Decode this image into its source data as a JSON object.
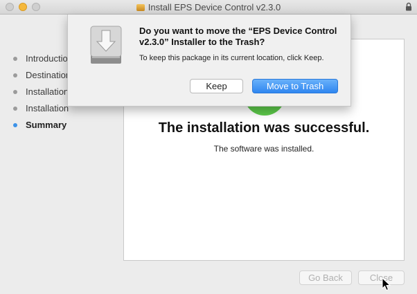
{
  "window": {
    "title": "Install EPS Device Control v2.3.0"
  },
  "sidebar": {
    "items": [
      {
        "label": "Introduction"
      },
      {
        "label": "Destination Select"
      },
      {
        "label": "Installation Type"
      },
      {
        "label": "Installation"
      },
      {
        "label": "Summary"
      }
    ],
    "active_index": 4
  },
  "content": {
    "headline": "The installation was successful.",
    "subline": "The software was installed."
  },
  "footer": {
    "back_label": "Go Back",
    "close_label": "Close"
  },
  "dialog": {
    "title": "Do you want to move the “EPS Device Control v2.3.0” Installer to the Trash?",
    "message": "To keep this package in its current location, click Keep.",
    "keep_label": "Keep",
    "trash_label": "Move to Trash"
  },
  "colors": {
    "accent": "#3c92e8",
    "default_button": "#2f86f0",
    "success": "#5dc94a"
  },
  "icons": {
    "window_icon": "package-icon",
    "lock": "lock-icon",
    "dialog_icon": "installer-icon"
  }
}
